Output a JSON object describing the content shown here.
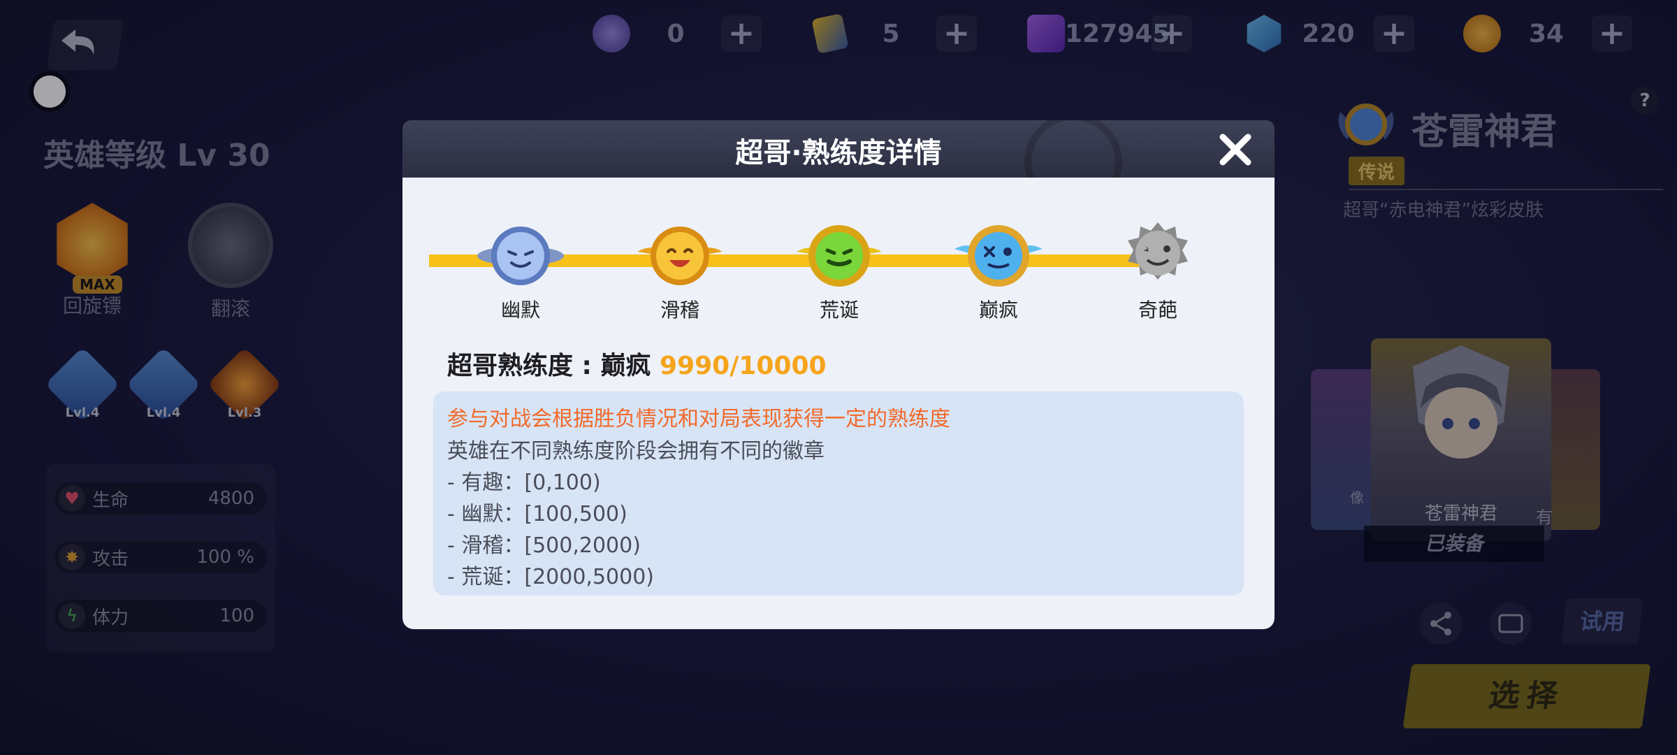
{
  "resources": [
    {
      "icon": "purple-star-coin-icon",
      "value": "0"
    },
    {
      "icon": "ticket-icon",
      "value": "5"
    },
    {
      "icon": "purple-cube-icon",
      "value": "127945"
    },
    {
      "icon": "blue-gem-icon",
      "value": "220"
    },
    {
      "icon": "gold-coin-icon",
      "value": "34"
    }
  ],
  "left": {
    "hero_level": "英雄等级 Lv 30",
    "skills": [
      {
        "name": "回旋镖",
        "badge": "MAX"
      },
      {
        "name": "翻滚"
      }
    ],
    "sub_skills": [
      {
        "level": "Lvl.4"
      },
      {
        "level": "Lvl.4"
      },
      {
        "level": "Lvl.3"
      }
    ],
    "stats": [
      {
        "icon": "heart-icon",
        "name": "生命",
        "value": "4800"
      },
      {
        "icon": "attack-burst-icon",
        "name": "攻击",
        "value": "100 %"
      },
      {
        "icon": "lightning-icon",
        "name": "体力",
        "value": "100"
      }
    ]
  },
  "right": {
    "skin_name": "苍雷神君",
    "rarity": "传说",
    "skin_desc": "超哥“赤电神君”炫彩皮肤",
    "help": "?",
    "card_name": "苍雷神君",
    "card_status": "已装备",
    "card_mini_left": "像",
    "card_mini_right": "有",
    "try_label": "试用",
    "select_label": "选择"
  },
  "modal": {
    "title": "超哥·熟练度详情",
    "badges": [
      {
        "name": "幽默",
        "color": "#8fb0ea"
      },
      {
        "name": "滑稽",
        "color": "#f6b51e"
      },
      {
        "name": "荒诞",
        "color": "#7fd23a"
      },
      {
        "name": "巅疯",
        "color": "#4fb6ef"
      },
      {
        "name": "奇葩",
        "color": "#a4a4a4"
      }
    ],
    "mastery_label": "超哥熟练度 : 巅疯",
    "mastery_value": "9990/10000",
    "info_highlight": "参与对战会根据胜负情况和对局表现获得一定的熟练度",
    "info_lines": [
      "英雄在不同熟练度阶段会拥有不同的徽章",
      "-   有趣：[0,100)",
      "-   幽默：[100,500)",
      "-   滑稽：[500,2000)",
      "-   荒诞：[2000,5000)"
    ]
  }
}
